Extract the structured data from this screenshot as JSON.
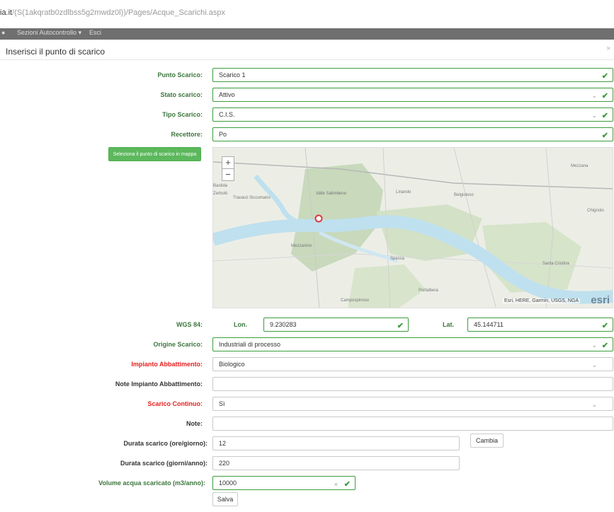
{
  "browser": {
    "url_host": "ia.it",
    "url_path": "/(S(1akqratb0zdlbss5g2mwdz0l))/Pages/Acque_Scarichi.aspx"
  },
  "navbar": {
    "item1": "Sezioni Autocontrollo",
    "item2": "Esci"
  },
  "modal": {
    "title": "Inserisci il punto di scarico",
    "close": "×"
  },
  "form": {
    "punto_scarico": {
      "label": "Punto Scarico:",
      "value": "Scarico 1"
    },
    "stato_scarico": {
      "label": "Stato scarico:",
      "value": "Attivo"
    },
    "tipo_scarico": {
      "label": "Tipo Scarico:",
      "value": "C.I.S."
    },
    "recettore": {
      "label": "Recettore:",
      "value": "Po"
    },
    "map_button": "Seleziona il punto di scarico in mappa",
    "wgs": {
      "label": "WGS 84:",
      "lon_label": "Lon.",
      "lon_value": "9.230283",
      "lat_label": "Lat.",
      "lat_value": "45.144711"
    },
    "origine_scarico": {
      "label": "Origine Scarico:",
      "value": "Industriali di processo"
    },
    "impianto_abbattimento": {
      "label": "Impianto Abbattimento:",
      "value": "Biologico"
    },
    "note_impianto": {
      "label": "Note Impianto Abbattimento:",
      "value": ""
    },
    "scarico_continuo": {
      "label": "Scarico Continuo:",
      "value": "Sì"
    },
    "note": {
      "label": "Note:",
      "value": ""
    },
    "durata_ore": {
      "label": "Durata scarico (ore/giorno):",
      "value": "12"
    },
    "cambia_button": "Cambia",
    "durata_giorni": {
      "label": "Durata scarico (giorni/anno):",
      "value": "220"
    },
    "volume": {
      "label": "Volume acqua scaricato (m3/anno):",
      "value": "10000"
    },
    "salva_button": "Salva"
  },
  "map": {
    "attribution": "Esri, HERE, Garmin, USGS, NGA",
    "logo": "esri",
    "zoom_in": "+",
    "zoom_out": "−",
    "places": [
      "Mezzana",
      "Bastida",
      "Travacò Siccomario",
      "Zerbolò",
      "Linarolo",
      "Valle Salimbene",
      "Chignolo",
      "Mezzanino",
      "Belgioioso",
      "Spessa",
      "Portalbera",
      "Campospinoso",
      "Santa Cristina"
    ],
    "colors": {
      "water": "#bfe0ee",
      "forest": "#c8d9bc",
      "land": "#eceee6"
    }
  },
  "colors": {
    "valid": "#3c9d3c",
    "required": "#e52020",
    "button": "#5cb85c"
  }
}
